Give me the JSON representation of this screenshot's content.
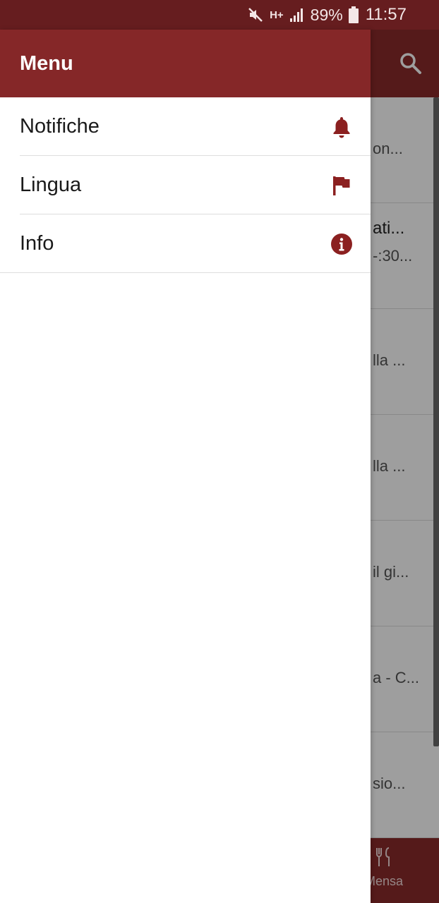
{
  "status_bar": {
    "network": "H+",
    "battery": "89%",
    "time": "11:57",
    "icons": [
      "mute-icon",
      "network-h-plus-icon",
      "signal-icon",
      "battery-icon"
    ]
  },
  "drawer": {
    "title": "Menu",
    "items": [
      {
        "label": "Notifiche",
        "icon": "bell-icon"
      },
      {
        "label": "Lingua",
        "icon": "flag-icon"
      },
      {
        "label": "Info",
        "icon": "info-icon"
      }
    ]
  },
  "background_list": {
    "items": [
      {
        "text": "on..."
      },
      {
        "title": "ati...",
        "sub": "-:30..."
      },
      {
        "text": "lla ..."
      },
      {
        "text": "lla ..."
      },
      {
        "text": "il gi..."
      },
      {
        "text": "a - C..."
      },
      {
        "text": "sio..."
      }
    ]
  },
  "bottom_nav": {
    "mensa_label": "Mensa"
  },
  "colors": {
    "status_bar": "#661d1f",
    "accent": "#852728",
    "icon": "#8b2020"
  }
}
